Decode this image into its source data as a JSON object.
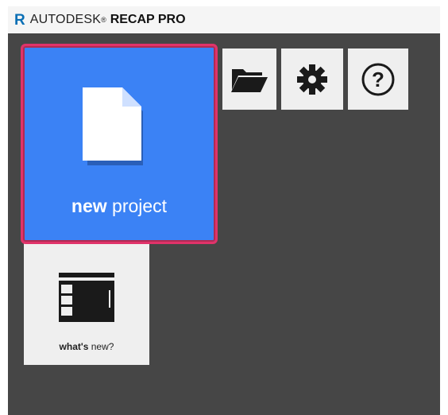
{
  "titlebar": {
    "logo_letter": "R",
    "brand": "AUTODESK",
    "registered_mark": "®",
    "product": "RECAP PRO"
  },
  "tiles": {
    "new_project": {
      "label_bold": "new",
      "label_rest": " project",
      "icon": "document-icon"
    },
    "open": {
      "icon": "folder-open-icon"
    },
    "settings": {
      "icon": "gear-icon"
    },
    "help": {
      "icon": "help-icon",
      "glyph": "?"
    },
    "whats_new": {
      "label_bold": "what's",
      "label_rest": " new?",
      "icon": "release-notes-icon"
    }
  },
  "colors": {
    "accent_blue": "#3b82f5",
    "highlight_border": "#e0336a",
    "background_dark": "#464646",
    "tile_light": "#efefef",
    "logo_blue": "#0a6fb5"
  }
}
